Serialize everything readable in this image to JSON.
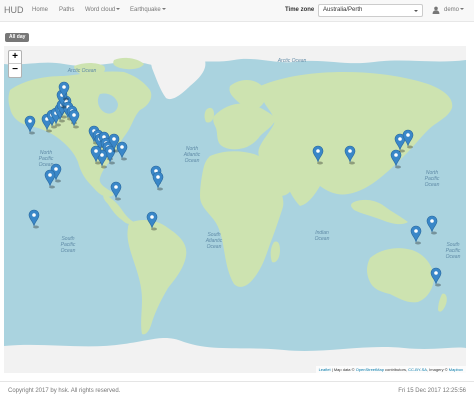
{
  "navbar": {
    "brand": "HUD",
    "items": [
      {
        "label": "Home",
        "dropdown": false
      },
      {
        "label": "Paths",
        "dropdown": false
      },
      {
        "label": "Word cloud",
        "dropdown": true
      },
      {
        "label": "Earthquake",
        "dropdown": true
      }
    ],
    "timezone_label": "Time zone",
    "timezone_value": "Australia/Perth",
    "user": "demo"
  },
  "badge": "All day",
  "map": {
    "zoom_in": "+",
    "zoom_out": "−",
    "labels": [
      {
        "text": "Arctic Ocean"
      },
      {
        "text": "Arctic Ocean"
      },
      {
        "text": "North Pacific Ocean"
      },
      {
        "text": "North Atlantic Ocean"
      },
      {
        "text": "North Pacific Ocean"
      },
      {
        "text": "South Pacific Ocean"
      },
      {
        "text": "South Atlantic Ocean"
      },
      {
        "text": "Indian Ocean"
      },
      {
        "text": "South Pacific Ocean"
      }
    ],
    "attribution": {
      "leaflet": "Leaflet",
      "mid": " | Map data © ",
      "osm": "OpenStreetMap",
      "contrib": " contributors, ",
      "license": "CC-BY-SA",
      "imagery": ", Imagery © ",
      "provider": "Mapbox"
    },
    "marker_color": "#3a87c8",
    "land_color": "#cde3b0",
    "ice_color": "#f2f2f2",
    "water_color": "#aad3df"
  },
  "footer": {
    "copyright": "Copyright 2017 by hsk. All rights reserved.",
    "datetime": "Fri 15 Dec 2017 12:25:56"
  }
}
